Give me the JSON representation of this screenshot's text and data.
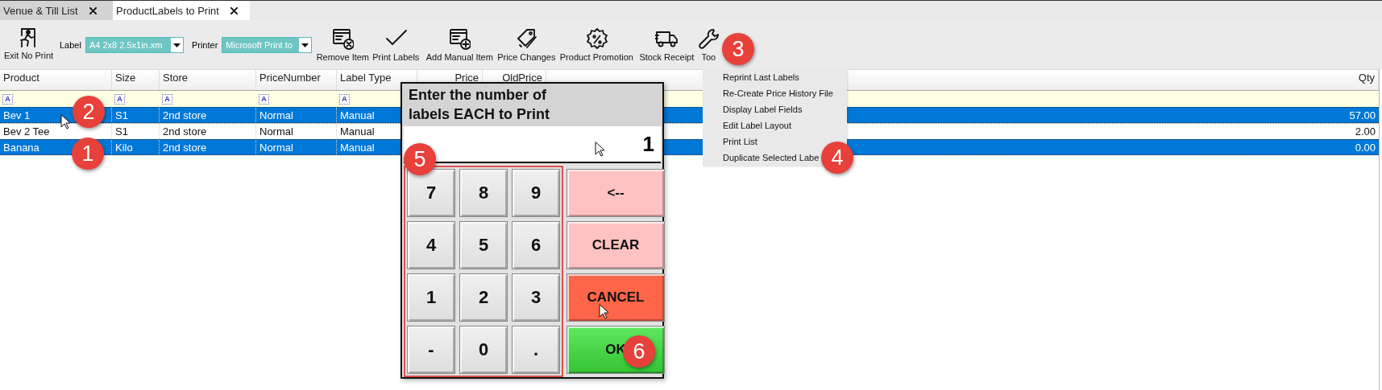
{
  "tabs": [
    {
      "label": "Venue & Till List",
      "selected": false
    },
    {
      "label": "ProductLabels to Print",
      "selected": true
    }
  ],
  "toolbar": {
    "exit": "Exit No Print",
    "label_field": {
      "label": "Label",
      "value": "A4 2x8 2.5x1in.xm"
    },
    "printer_field": {
      "label": "Printer",
      "value": "Microsoft Print to"
    },
    "buttons": [
      "Remove Item",
      "Print Labels",
      "Add Manual Item",
      "Price Changes",
      "Product Promotion",
      "Stock Receipt",
      "Too"
    ]
  },
  "table": {
    "columns": [
      {
        "label": "Product",
        "filter_icon": "A"
      },
      {
        "label": "Size",
        "filter_icon": "A"
      },
      {
        "label": "Store",
        "filter_icon": "A"
      },
      {
        "label": "PriceNumber",
        "filter_icon": "A"
      },
      {
        "label": "Label Type",
        "filter_icon": "A"
      },
      {
        "label": "Price"
      },
      {
        "label": "OldPrice"
      },
      {
        "label": "Qty"
      }
    ],
    "rows": [
      {
        "cells": [
          "Bev 1",
          "S1",
          "2nd store",
          "Normal",
          "Manual"
        ],
        "qty": "57.00",
        "selected": true
      },
      {
        "cells": [
          "Bev 2 Tee",
          "S1",
          "2nd store",
          "Normal",
          "Manual"
        ],
        "qty": "2.00",
        "selected": false
      },
      {
        "cells": [
          "Banana",
          "Kilo",
          "2nd store",
          "Normal",
          "Manual"
        ],
        "qty": "0.00",
        "selected": true
      }
    ]
  },
  "tools_menu": {
    "items": [
      "Reprint Last Labels",
      "Re-Create Price History File",
      "Display Label Fields",
      "Edit Label Layout",
      "Print List",
      "Duplicate Selected Labe"
    ]
  },
  "dialog": {
    "title_lines": [
      "Enter the number of",
      "labels EACH to Print"
    ],
    "value": "1",
    "digit_keys": [
      "7",
      "8",
      "9",
      "4",
      "5",
      "6",
      "1",
      "2",
      "3",
      "-",
      "0",
      "."
    ],
    "action_keys": [
      {
        "label": "<--",
        "kind": "backspace"
      },
      {
        "label": "CLEAR",
        "kind": "clear"
      },
      {
        "label": "CANCEL",
        "kind": "cancel"
      },
      {
        "label": "OK",
        "kind": "ok"
      }
    ]
  },
  "callouts": [
    "3",
    "2",
    "1",
    "5",
    "4",
    "6"
  ]
}
